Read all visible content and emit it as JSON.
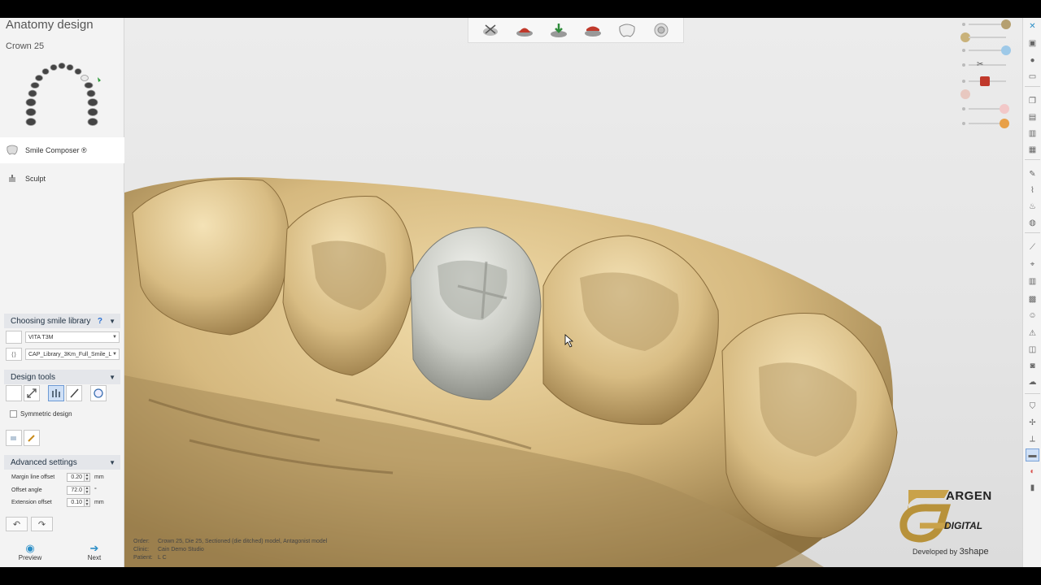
{
  "panel": {
    "title": "Anatomy design",
    "crown_label": "Crown 25",
    "items": [
      {
        "label": "Smile Composer ®",
        "icon": "tooth-icon"
      },
      {
        "label": "Sculpt",
        "icon": "sculpt-icon"
      }
    ]
  },
  "smile_library": {
    "header": "Choosing smile library",
    "help": "?",
    "shade_value": "VITA T3M",
    "library_value": "CAP_Library_3Km_Full_Smile_L"
  },
  "design_tools": {
    "header": "Design tools",
    "symmetric_label": "Symmetric design",
    "symmetric_checked": false,
    "selected_tool_index": 2
  },
  "advanced": {
    "header": "Advanced settings",
    "rows": [
      {
        "label": "Margin line offset",
        "value": "0.20",
        "unit": "mm"
      },
      {
        "label": "Offset angle",
        "value": "72.0",
        "unit": "°"
      },
      {
        "label": "Extension offset",
        "value": "0.10",
        "unit": "mm"
      }
    ]
  },
  "nav": {
    "preview_label": "Preview",
    "next_label": "Next"
  },
  "info": {
    "order_key": "Order:",
    "order_value": "Crown 25, Die 25, Sectioned (die ditched) model, Antagonist model",
    "clinic_key": "Clinic:",
    "clinic_value": "Cain Demo Studio",
    "patient_key": "Patient:",
    "patient_value": "L C"
  },
  "logo": {
    "brand": "ARGEN",
    "sub": "DIGITAL",
    "developed_prefix": "Developed by",
    "developer": "3shape"
  },
  "colors": {
    "accent": "#2d8fc7",
    "model_gold": "#d9bd85",
    "crown_grey": "#c9cbc4",
    "logo_gold": "#c9a24a"
  },
  "top_toolbar": [
    "scissors-margin-icon",
    "die-icon",
    "insertion-icon",
    "antagonist-icon",
    "crown-icon",
    "target-icon"
  ],
  "right_toolbar": [
    "close-icon",
    "collapse-icon",
    "zoom-icon",
    "view-front-icon",
    "view-copy-icon",
    "view-side-icon",
    "view-top-icon",
    "view-bottom-icon",
    "pen-icon",
    "spline-icon",
    "brush-icon",
    "smooth-icon",
    "wax-knife-icon",
    "measure-icon",
    "section-icon",
    "scan-icon",
    "face-icon",
    "warning-icon",
    "mesh-icon",
    "camera-icon",
    "cloud-icon",
    "shield-icon",
    "plane-icon",
    "axis-icon",
    "ruler-icon",
    "color-icon",
    "lock-icon"
  ]
}
